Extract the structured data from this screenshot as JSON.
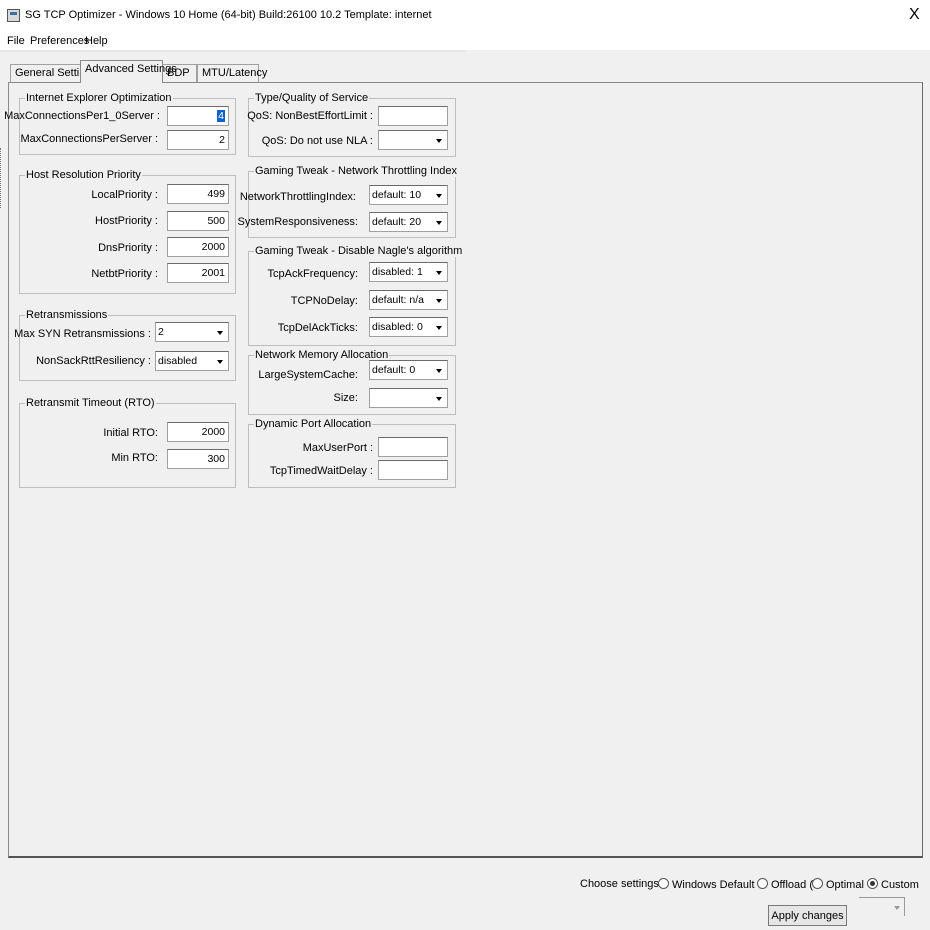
{
  "window": {
    "title": "SG TCP Optimizer - Windows 10 Home (64-bit) Build:26100 10.2  Template: internet",
    "close_label": "X"
  },
  "menu": [
    "File",
    "Preferences",
    "Help"
  ],
  "tabs": [
    "General Settings",
    "Advanced Settings",
    "BDP",
    "MTU/Latency"
  ],
  "active_tab": "Advanced Settings",
  "ie_optimization": {
    "title": "Internet Explorer Optimization",
    "fields": [
      {
        "label": "MaxConnectionsPer1_0Server :",
        "value": "4"
      },
      {
        "label": "MaxConnectionsPerServer :",
        "value": "2"
      }
    ]
  },
  "host_resolution": {
    "title": "Host Resolution Priority",
    "fields": [
      {
        "label": "LocalPriority :",
        "value": "499"
      },
      {
        "label": "HostPriority :",
        "value": "500"
      },
      {
        "label": "DnsPriority :",
        "value": "2000"
      },
      {
        "label": "NetbtPriority :",
        "value": "2001"
      }
    ]
  },
  "retransmissions": {
    "title": "Retransmissions",
    "fields": [
      {
        "label": "Max SYN Retransmissions :",
        "value": "2"
      },
      {
        "label": "NonSackRttResiliency :",
        "value": "disabled"
      }
    ]
  },
  "rto": {
    "title": "Retransmit Timeout (RTO)",
    "fields": [
      {
        "label": "Initial RTO:",
        "value": "2000"
      },
      {
        "label": "Min RTO:",
        "value": "300"
      }
    ]
  },
  "qos": {
    "title": "Type/Quality of Service",
    "fields": [
      {
        "label": "QoS: NonBestEffortLimit :",
        "value": ""
      },
      {
        "label": "QoS: Do not use NLA :",
        "value": ""
      }
    ]
  },
  "throttling": {
    "title": "Gaming Tweak - Network Throttling Index",
    "fields": [
      {
        "label": "NetworkThrottlingIndex:",
        "value": "default: 10"
      },
      {
        "label": "SystemResponsiveness:",
        "value": "default: 20"
      }
    ]
  },
  "nagle": {
    "title": "Gaming Tweak - Disable Nagle's algorithm",
    "fields": [
      {
        "label": "TcpAckFrequency:",
        "value": "disabled: 1"
      },
      {
        "label": "TCPNoDelay:",
        "value": "default: n/a"
      },
      {
        "label": "TcpDelAckTicks:",
        "value": "disabled: 0"
      }
    ]
  },
  "memory": {
    "title": "Network Memory Allocation",
    "fields": [
      {
        "label": "LargeSystemCache:",
        "value": "default: 0"
      },
      {
        "label": "Size:",
        "value": ""
      }
    ]
  },
  "ports": {
    "title": "Dynamic Port Allocation",
    "fields": [
      {
        "label": "MaxUserPort :",
        "value": ""
      },
      {
        "label": "TcpTimedWaitDelay :",
        "value": ""
      }
    ]
  },
  "bottom": {
    "choose_label": "Choose settings:",
    "options": [
      "Windows Default",
      "Offload (L",
      "Optimal",
      "Custom"
    ],
    "selected": "Custom",
    "apply_label": "Apply changes"
  }
}
